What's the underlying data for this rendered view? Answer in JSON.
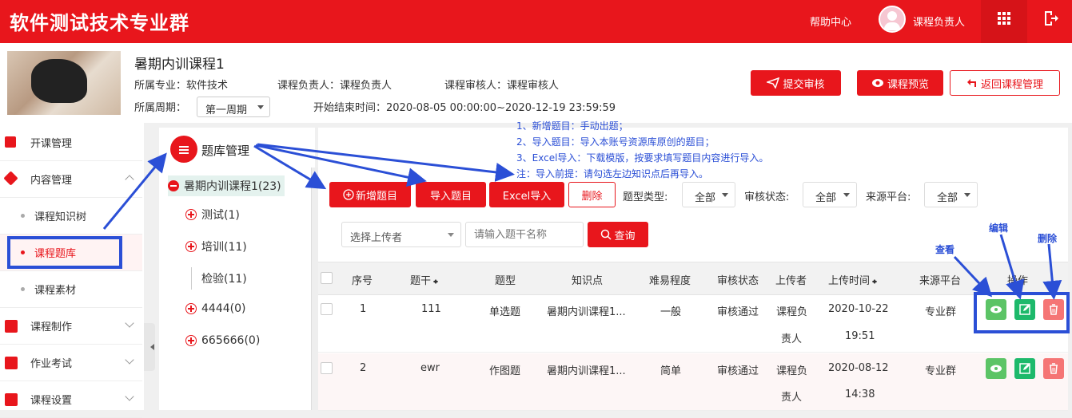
{
  "topbar": {
    "brand": "软件测试技术专业群",
    "help": "帮助中心",
    "user": "课程负责人"
  },
  "course": {
    "name": "暑期内训课程1",
    "major": "所属专业：软件技术",
    "owner": "课程负责人：课程负责人",
    "reviewer": "课程审核人：课程审核人",
    "period_label": "所属周期：",
    "period_value": "第一周期",
    "time": "开始结束时间：2020-08-05 00:00:00~2020-12-19 23:59:59"
  },
  "header_buttons": {
    "submit": "提交审核",
    "preview": "课程预览",
    "back": "返回课程管理"
  },
  "sidebar": {
    "open": "开课管理",
    "content": "内容管理",
    "tree": "课程知识树",
    "bank": "课程题库",
    "material": "课程素材",
    "make": "课程制作",
    "exam": "作业考试",
    "settings": "课程设置"
  },
  "bank_title": "题库管理",
  "tree": [
    {
      "label": "暑期内训课程1(23)"
    },
    {
      "label": "测试(1)"
    },
    {
      "label": "培训(11)"
    },
    {
      "label": "检验(11)"
    },
    {
      "label": "4444(0)"
    },
    {
      "label": "665666(0)"
    }
  ],
  "notes": [
    "1、新增题目：手动出题；",
    "2、导入题目：导入本账号资源库原创的题目；",
    "3、Excel导入：下载模版，按要求填写题目内容进行导入。",
    "注：导入前提：请勾选左边知识点后再导入。"
  ],
  "toolbar": {
    "add": "新增题目",
    "import": "导入题目",
    "excel": "Excel导入",
    "delete": "删除"
  },
  "filters": {
    "type_label": "题型类型:",
    "type_value": "全部",
    "review_label": "审核状态:",
    "review_value": "全部",
    "source_label": "来源平台:",
    "source_value": "全部"
  },
  "search": {
    "uploader": "选择上传者",
    "placeholder": "请输入题干名称",
    "query": "查询"
  },
  "table": {
    "headers": [
      "序号",
      "题干",
      "题型",
      "知识点",
      "难易程度",
      "审核状态",
      "上传者",
      "上传时间",
      "来源平台",
      "操作"
    ],
    "rows": [
      {
        "no": "1",
        "stem": "111",
        "type": "单选题",
        "point": "暑期内训课程1...",
        "level": "一般",
        "review": "审核通过",
        "up1": "课程负",
        "up2": "责人",
        "date": "2020-10-22",
        "time": "19:51",
        "source": "专业群"
      },
      {
        "no": "2",
        "stem": "ewr",
        "type": "作图题",
        "point": "暑期内训课程1...",
        "level": "简单",
        "review": "审核通过",
        "up1": "课程负",
        "up2": "责人",
        "date": "2020-08-12",
        "time": "14:38",
        "source": "专业群"
      }
    ]
  },
  "annotations": {
    "view": "查看",
    "edit": "编辑",
    "del": "删除"
  },
  "colors": {
    "brand_red": "#e8161c",
    "annotation_blue": "#2b4fd6"
  }
}
